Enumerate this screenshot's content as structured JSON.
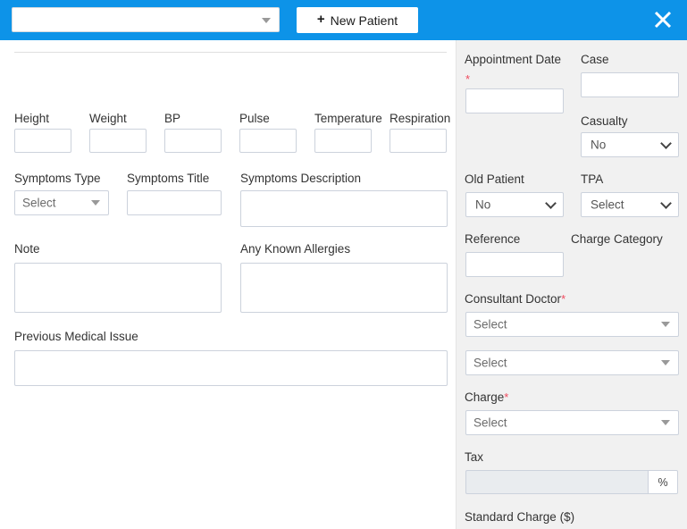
{
  "header": {
    "patient_select_value": "",
    "patient_select_placeholder": "",
    "new_patient_label": "New Patient",
    "plus_glyph": "+",
    "close_icon": "close-icon",
    "accent_color": "#0d93e8"
  },
  "main": {
    "vitals": [
      {
        "label": "Height",
        "value": ""
      },
      {
        "label": "Weight",
        "value": ""
      },
      {
        "label": "BP",
        "value": ""
      },
      {
        "label": "Pulse",
        "value": ""
      },
      {
        "label": "Temperature",
        "value": ""
      },
      {
        "label": "Respiration",
        "value": ""
      }
    ],
    "symptoms_type": {
      "label": "Symptoms Type",
      "value": "Select"
    },
    "symptoms_title": {
      "label": "Symptoms Title",
      "value": ""
    },
    "symptoms_description": {
      "label": "Symptoms Description",
      "value": ""
    },
    "note": {
      "label": "Note",
      "value": ""
    },
    "allergies": {
      "label": "Any Known Allergies",
      "value": ""
    },
    "previous_medical_issue": {
      "label": "Previous Medical Issue",
      "value": ""
    }
  },
  "sidebar": {
    "appointment_date": {
      "label": "Appointment Date",
      "required": "*",
      "value": ""
    },
    "case": {
      "label": "Case",
      "value": ""
    },
    "casualty": {
      "label": "Casualty",
      "value": "No"
    },
    "old_patient": {
      "label": "Old Patient",
      "value": "No"
    },
    "tpa": {
      "label": "TPA",
      "value": "Select"
    },
    "reference": {
      "label": "Reference",
      "value": ""
    },
    "charge_category": {
      "label": "Charge Category"
    },
    "consultant_doctor": {
      "label": "Consultant Doctor",
      "required": "*",
      "value": "Select"
    },
    "consultant_doctor_second": {
      "value": "Select"
    },
    "charge": {
      "label": "Charge",
      "required": "*",
      "value": "Select"
    },
    "tax": {
      "label": "Tax",
      "value": "",
      "suffix": "%"
    },
    "standard_charge": {
      "label": "Standard Charge ($)"
    }
  },
  "colors": {
    "header_blue": "#0d93e8",
    "sidebar_gray": "#f1f1f1",
    "border": "#ccd2dc",
    "required_red": "#ef4a5e"
  }
}
